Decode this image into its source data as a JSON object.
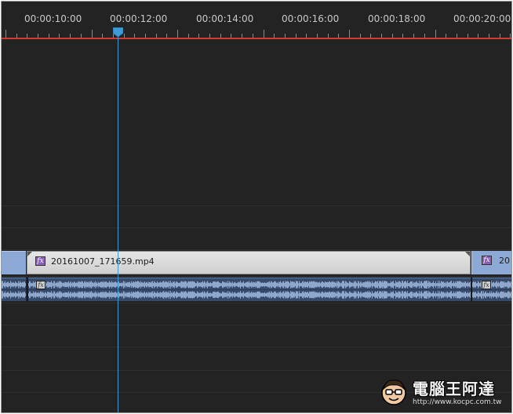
{
  "ruler": {
    "timecodes": [
      "00:00:10:00",
      "00:00:12:00",
      "00:00:14:00",
      "00:00:16:00",
      "00:00:18:00",
      "00:00:20:00"
    ]
  },
  "tracks": {
    "video": {
      "clips": [
        {
          "label": "",
          "fx": ""
        },
        {
          "label": "20161007_171659.mp4",
          "fx": "fx"
        },
        {
          "label": "20",
          "fx": "fx"
        }
      ]
    },
    "audio": {
      "clips": [
        {
          "fx": ""
        },
        {
          "fx": "fx"
        },
        {
          "fx": "fx"
        }
      ]
    }
  },
  "watermark": {
    "title": "電腦王阿達",
    "url": "http://www.kocpc.com.tw"
  },
  "colors": {
    "background": "#232323",
    "work_area_bar": "#d03a2f",
    "playhead": "#3f9ad6",
    "video_clip_selected": "#d9d9d9",
    "video_clip": "#8ca9d6",
    "audio_clip": "#364b6b",
    "fx_badge": "#8a5fb6"
  },
  "icons": {
    "playhead": "playhead-marker-icon",
    "effect": "fx-badge-icon"
  }
}
